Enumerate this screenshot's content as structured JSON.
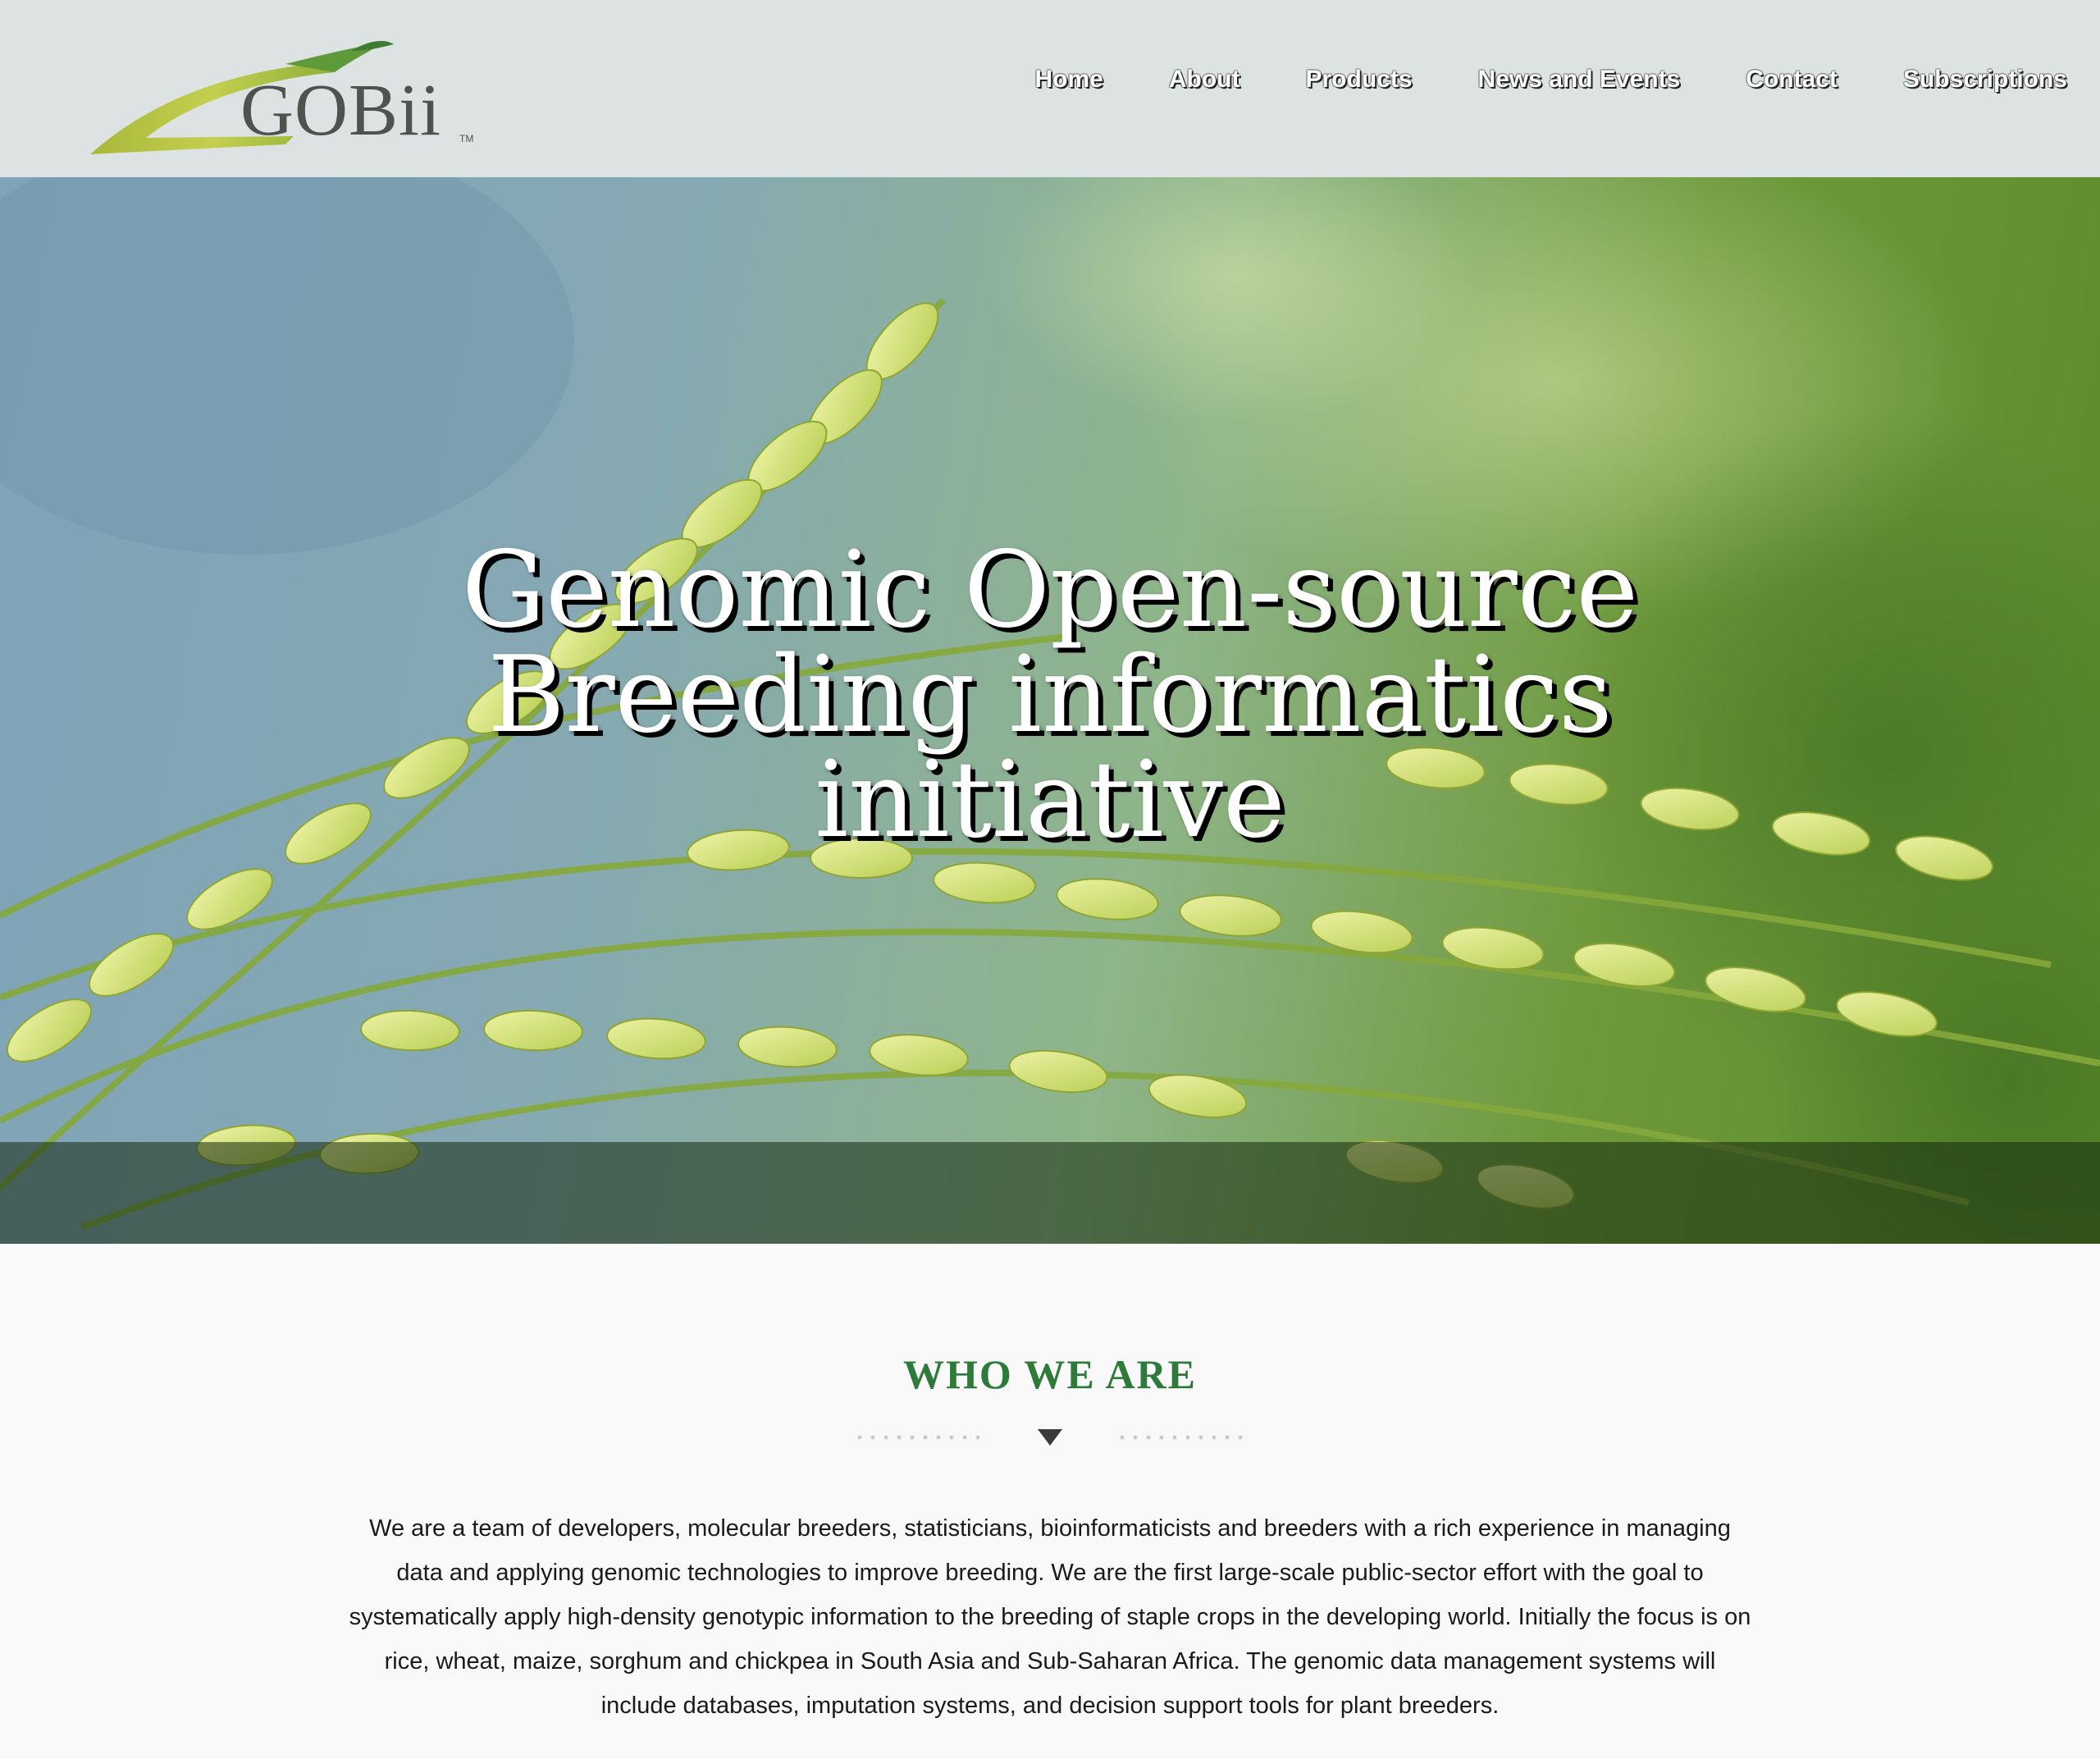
{
  "header": {
    "logo_text": "GOBii",
    "logo_tm": "TM",
    "nav": [
      {
        "label": "Home"
      },
      {
        "label": "About"
      },
      {
        "label": "Products"
      },
      {
        "label": "News and Events"
      },
      {
        "label": "Contact"
      },
      {
        "label": "Subscriptions"
      }
    ]
  },
  "hero": {
    "title_line1": "Genomic Open-source",
    "title_line2": "Breeding informatics",
    "title_line3": "initiative",
    "image_icon": "rice-panicle-photo"
  },
  "who_we_are": {
    "title": "WHO WE ARE",
    "divider_icon": "triangle-down-icon",
    "body": "We are a team of developers, molecular breeders, statisticians, bioinformaticists and breeders with a rich experience in managing data and applying genomic technologies to improve breeding. We are the first large-scale public-sector effort with the goal to systematically apply high-density genotypic information to the breeding of staple crops in the developing world. Initially the focus is on rice, wheat, maize, sorghum and chickpea in South Asia and Sub-Saharan Africa. The genomic data management systems will include databases, imputation systems, and decision support tools for plant breeders."
  },
  "colors": {
    "header_bg": "#dde2e2",
    "accent_green": "#2e7a3a",
    "logo_lime": "#b3c23a",
    "logo_leaf": "#3f7a32"
  }
}
